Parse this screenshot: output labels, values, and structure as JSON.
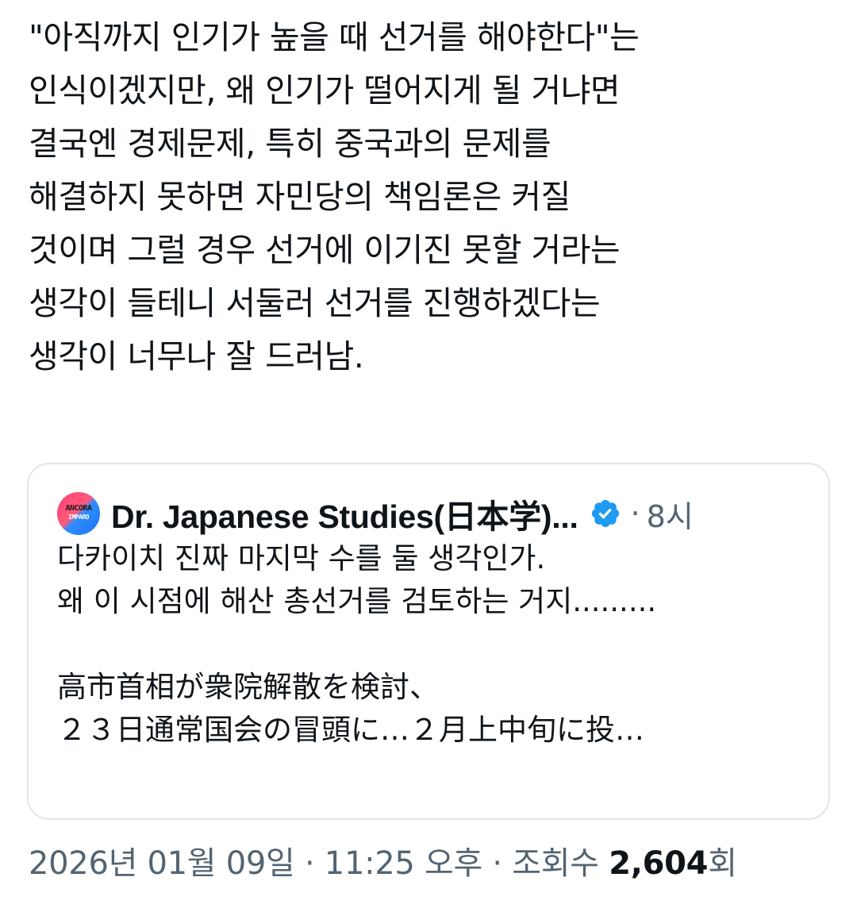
{
  "tweet": {
    "lines": [
      "\"아직까지 인기가 높을 때 선거를 해야한다\"는",
      "인식이겠지만, 왜 인기가 떨어지게 될 거냐면",
      "결국엔 경제문제, 특히 중국과의 문제를",
      "해결하지 못하면 자민당의 책임론은 커질",
      "것이며 그럴 경우 선거에 이기진 못할 거라는",
      "생각이 들테니 서둘러 선거를 진행하겠다는",
      "생각이 너무나 잘 드러남."
    ]
  },
  "quote": {
    "avatar_text_top": "ANCORA",
    "avatar_text_bottom": "IMPARO",
    "author": "Dr. Japanese Studies(日本学)...",
    "separator": "·",
    "time": "8시",
    "lines": [
      "다카이치 진짜 마지막 수를 둘 생각인가.",
      "왜 이 시점에 해산 총선거를 검토하는 거지.........",
      "",
      "高市首相が衆院解散を検討、",
      "２３日通常国会の冒頭に…２月上中旬に投…"
    ]
  },
  "footer": {
    "date": "2026년 01월 09일",
    "sep1": "·",
    "time": "11:25 오후",
    "sep2": "·",
    "views_label": "조회수",
    "views_count": "2,604",
    "views_suffix": "회"
  },
  "colors": {
    "text": "#0f1419",
    "secondary": "#536471",
    "verified": "#1d9bf0",
    "border": "#e1e6ea"
  }
}
